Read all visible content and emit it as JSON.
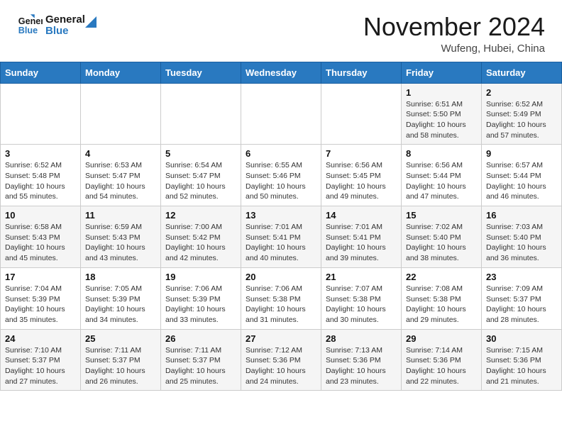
{
  "header": {
    "logo_line1": "General",
    "logo_line2": "Blue",
    "month": "November 2024",
    "location": "Wufeng, Hubei, China"
  },
  "weekdays": [
    "Sunday",
    "Monday",
    "Tuesday",
    "Wednesday",
    "Thursday",
    "Friday",
    "Saturday"
  ],
  "weeks": [
    [
      {
        "day": "",
        "info": ""
      },
      {
        "day": "",
        "info": ""
      },
      {
        "day": "",
        "info": ""
      },
      {
        "day": "",
        "info": ""
      },
      {
        "day": "",
        "info": ""
      },
      {
        "day": "1",
        "info": "Sunrise: 6:51 AM\nSunset: 5:50 PM\nDaylight: 10 hours\nand 58 minutes."
      },
      {
        "day": "2",
        "info": "Sunrise: 6:52 AM\nSunset: 5:49 PM\nDaylight: 10 hours\nand 57 minutes."
      }
    ],
    [
      {
        "day": "3",
        "info": "Sunrise: 6:52 AM\nSunset: 5:48 PM\nDaylight: 10 hours\nand 55 minutes."
      },
      {
        "day": "4",
        "info": "Sunrise: 6:53 AM\nSunset: 5:47 PM\nDaylight: 10 hours\nand 54 minutes."
      },
      {
        "day": "5",
        "info": "Sunrise: 6:54 AM\nSunset: 5:47 PM\nDaylight: 10 hours\nand 52 minutes."
      },
      {
        "day": "6",
        "info": "Sunrise: 6:55 AM\nSunset: 5:46 PM\nDaylight: 10 hours\nand 50 minutes."
      },
      {
        "day": "7",
        "info": "Sunrise: 6:56 AM\nSunset: 5:45 PM\nDaylight: 10 hours\nand 49 minutes."
      },
      {
        "day": "8",
        "info": "Sunrise: 6:56 AM\nSunset: 5:44 PM\nDaylight: 10 hours\nand 47 minutes."
      },
      {
        "day": "9",
        "info": "Sunrise: 6:57 AM\nSunset: 5:44 PM\nDaylight: 10 hours\nand 46 minutes."
      }
    ],
    [
      {
        "day": "10",
        "info": "Sunrise: 6:58 AM\nSunset: 5:43 PM\nDaylight: 10 hours\nand 45 minutes."
      },
      {
        "day": "11",
        "info": "Sunrise: 6:59 AM\nSunset: 5:43 PM\nDaylight: 10 hours\nand 43 minutes."
      },
      {
        "day": "12",
        "info": "Sunrise: 7:00 AM\nSunset: 5:42 PM\nDaylight: 10 hours\nand 42 minutes."
      },
      {
        "day": "13",
        "info": "Sunrise: 7:01 AM\nSunset: 5:41 PM\nDaylight: 10 hours\nand 40 minutes."
      },
      {
        "day": "14",
        "info": "Sunrise: 7:01 AM\nSunset: 5:41 PM\nDaylight: 10 hours\nand 39 minutes."
      },
      {
        "day": "15",
        "info": "Sunrise: 7:02 AM\nSunset: 5:40 PM\nDaylight: 10 hours\nand 38 minutes."
      },
      {
        "day": "16",
        "info": "Sunrise: 7:03 AM\nSunset: 5:40 PM\nDaylight: 10 hours\nand 36 minutes."
      }
    ],
    [
      {
        "day": "17",
        "info": "Sunrise: 7:04 AM\nSunset: 5:39 PM\nDaylight: 10 hours\nand 35 minutes."
      },
      {
        "day": "18",
        "info": "Sunrise: 7:05 AM\nSunset: 5:39 PM\nDaylight: 10 hours\nand 34 minutes."
      },
      {
        "day": "19",
        "info": "Sunrise: 7:06 AM\nSunset: 5:39 PM\nDaylight: 10 hours\nand 33 minutes."
      },
      {
        "day": "20",
        "info": "Sunrise: 7:06 AM\nSunset: 5:38 PM\nDaylight: 10 hours\nand 31 minutes."
      },
      {
        "day": "21",
        "info": "Sunrise: 7:07 AM\nSunset: 5:38 PM\nDaylight: 10 hours\nand 30 minutes."
      },
      {
        "day": "22",
        "info": "Sunrise: 7:08 AM\nSunset: 5:38 PM\nDaylight: 10 hours\nand 29 minutes."
      },
      {
        "day": "23",
        "info": "Sunrise: 7:09 AM\nSunset: 5:37 PM\nDaylight: 10 hours\nand 28 minutes."
      }
    ],
    [
      {
        "day": "24",
        "info": "Sunrise: 7:10 AM\nSunset: 5:37 PM\nDaylight: 10 hours\nand 27 minutes."
      },
      {
        "day": "25",
        "info": "Sunrise: 7:11 AM\nSunset: 5:37 PM\nDaylight: 10 hours\nand 26 minutes."
      },
      {
        "day": "26",
        "info": "Sunrise: 7:11 AM\nSunset: 5:37 PM\nDaylight: 10 hours\nand 25 minutes."
      },
      {
        "day": "27",
        "info": "Sunrise: 7:12 AM\nSunset: 5:36 PM\nDaylight: 10 hours\nand 24 minutes."
      },
      {
        "day": "28",
        "info": "Sunrise: 7:13 AM\nSunset: 5:36 PM\nDaylight: 10 hours\nand 23 minutes."
      },
      {
        "day": "29",
        "info": "Sunrise: 7:14 AM\nSunset: 5:36 PM\nDaylight: 10 hours\nand 22 minutes."
      },
      {
        "day": "30",
        "info": "Sunrise: 7:15 AM\nSunset: 5:36 PM\nDaylight: 10 hours\nand 21 minutes."
      }
    ]
  ]
}
